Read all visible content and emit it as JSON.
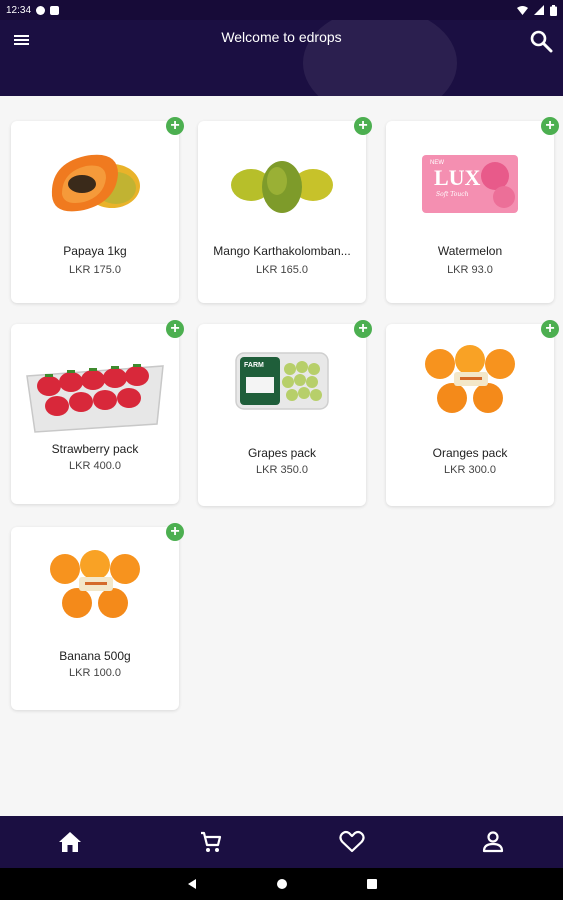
{
  "status_bar": {
    "time": "12:34"
  },
  "header": {
    "title": "Welcome to edrops"
  },
  "products": [
    {
      "name": "Papaya 1kg",
      "price": "LKR 175.0"
    },
    {
      "name": "Mango Karthakolomban...",
      "price": "LKR 165.0"
    },
    {
      "name": "Watermelon",
      "price": "LKR 93.0",
      "image_text": {
        "badge": "NEW",
        "brand": "LUX",
        "script": "Soft Touch"
      }
    },
    {
      "name": "Strawberry pack",
      "price": "LKR 400.0"
    },
    {
      "name": "Grapes pack",
      "price": "LKR 350.0",
      "image_text": {
        "brand": "FARM"
      }
    },
    {
      "name": "Oranges pack",
      "price": "LKR 300.0"
    },
    {
      "name": "Banana 500g",
      "price": "LKR 100.0"
    }
  ],
  "add_button": {
    "label": "+"
  },
  "bottom_nav": {
    "items": [
      "home-icon",
      "cart-icon",
      "favorite-icon",
      "account-icon"
    ]
  },
  "colors": {
    "bar": "#1b0f42",
    "add_button": "#4caf50",
    "background": "#f6f6f6"
  }
}
